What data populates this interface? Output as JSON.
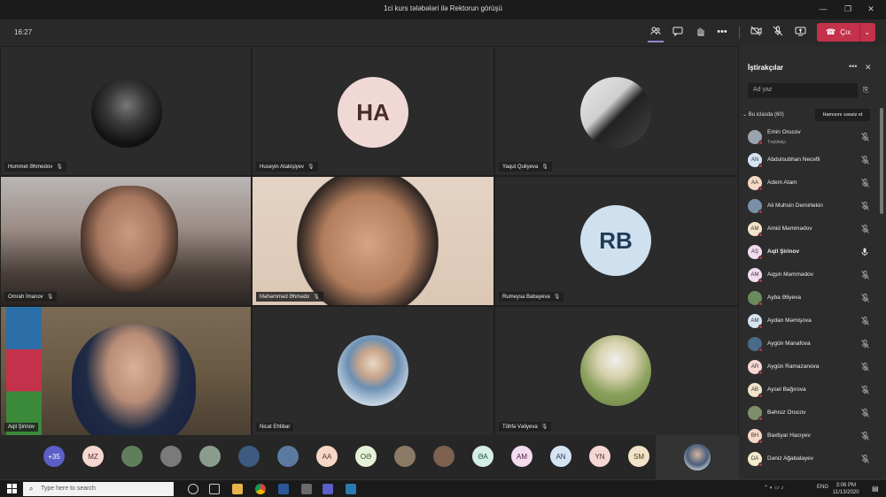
{
  "window": {
    "title": "1ci kurs tələbələri ilə Rektorun görüşü",
    "controls": {
      "minimize": "—",
      "maximize": "❐",
      "close": "✕"
    }
  },
  "toolbar": {
    "elapsed": "16:27",
    "leave_label": "Çıx",
    "icons": [
      "participants-icon",
      "chat-icon",
      "raise-hand-icon",
      "more-actions-icon",
      "camera-off-icon",
      "mic-off-icon",
      "share-screen-icon"
    ]
  },
  "tiles": [
    {
      "name": "Hummet Əhmedov",
      "type": "photo",
      "color": "#1a1a1a"
    },
    {
      "name": "Huseyin Atakişiyev",
      "type": "initials",
      "initials": "HA",
      "bg": "#f0d9d5",
      "fg": "#4a2b28"
    },
    {
      "name": "Yaqut Quliyeva",
      "type": "photo",
      "color": "#d9d9d9"
    },
    {
      "name": "Omrah İmanov",
      "type": "video",
      "color": "#8d8380"
    },
    {
      "name": "Məhəmməd Əhmədo",
      "type": "video",
      "color": "#c9a48c"
    },
    {
      "name": "Rumeysa Babayeva",
      "type": "initials",
      "initials": "RB",
      "bg": "#cfe0ee",
      "fg": "#1f3b57"
    },
    {
      "name": "Aqil Şirinov",
      "type": "video",
      "color": "#6b5940"
    },
    {
      "name": "Nicat Ehtibar",
      "type": "photo",
      "color": "#4a6c8c"
    },
    {
      "name": "Töhfə Vəliyeva",
      "type": "photo",
      "color": "#b7b085"
    }
  ],
  "strip": [
    {
      "label": "+35",
      "bg": "#5b5fc7",
      "fg": "#ffffff"
    },
    {
      "label": "MZ",
      "bg": "#f6d7d2",
      "fg": "#4a2b28"
    },
    {
      "label": "",
      "bg": "#607d5c",
      "fg": "#ffffff"
    },
    {
      "label": "",
      "bg": "#7a7a7a",
      "fg": "#ffffff"
    },
    {
      "label": "",
      "bg": "#8c9c8a",
      "fg": "#ffffff"
    },
    {
      "label": "",
      "bg": "#3d5a80",
      "fg": "#ffffff"
    },
    {
      "label": "",
      "bg": "#5a7aa0",
      "fg": "#ffffff"
    },
    {
      "label": "AA",
      "bg": "#f6d7c6",
      "fg": "#5a3020"
    },
    {
      "label": "OƏ",
      "bg": "#e5f2d9",
      "fg": "#2b4a1f"
    },
    {
      "label": "",
      "bg": "#8a7a66",
      "fg": "#ffffff"
    },
    {
      "label": "",
      "bg": "#7d6050",
      "fg": "#ffffff"
    },
    {
      "label": "ƏA",
      "bg": "#d6efe5",
      "fg": "#1f4a3a"
    },
    {
      "label": "AM",
      "bg": "#f3dcef",
      "fg": "#4a2046"
    },
    {
      "label": "AN",
      "bg": "#d5e4f2",
      "fg": "#1f3b57"
    },
    {
      "label": "YN",
      "bg": "#f6d7d2",
      "fg": "#4a2b28"
    },
    {
      "label": "SM",
      "bg": "#f1e4c9",
      "fg": "#4a3b1f"
    }
  ],
  "panel": {
    "title": "İştirakçılar",
    "search_placeholder": "Ad yaz",
    "section": "Bu iclasda (60)",
    "mute_all": "Hamısını səssiz et",
    "participants": [
      {
        "name": "Emin Orucov",
        "role": "Təşkilatçı",
        "initials": "",
        "bg": "#9aa3ad",
        "bold": false,
        "mic": "muted"
      },
      {
        "name": "Abdulsubhan Necefli",
        "role": "",
        "initials": "AN",
        "bg": "#d5e4f2",
        "bold": false,
        "mic": "muted"
      },
      {
        "name": "Adem Atam",
        "role": "",
        "initials": "AA",
        "bg": "#f6d7c6",
        "bold": false,
        "mic": "muted"
      },
      {
        "name": "Ali Muhsin Demirtekin",
        "role": "",
        "initials": "",
        "bg": "#7a8fa8",
        "bold": false,
        "mic": "muted"
      },
      {
        "name": "Amid Məmmədov",
        "role": "",
        "initials": "AM",
        "bg": "#f1e4c9",
        "bold": false,
        "mic": "muted"
      },
      {
        "name": "Aqil Şirinov",
        "role": "",
        "initials": "AŞ",
        "bg": "#f3dcef",
        "bold": true,
        "mic": "on"
      },
      {
        "name": "Aqşin Məmmədov",
        "role": "",
        "initials": "AM",
        "bg": "#f3dcef",
        "bold": false,
        "mic": "muted"
      },
      {
        "name": "Ayba Əliyeva",
        "role": "",
        "initials": "",
        "bg": "#6b8a5c",
        "bold": false,
        "mic": "muted"
      },
      {
        "name": "Aydan Məmişova",
        "role": "",
        "initials": "AM",
        "bg": "#d5e4f2",
        "bold": false,
        "mic": "muted"
      },
      {
        "name": "Aygün Manafova",
        "role": "",
        "initials": "",
        "bg": "#4a6a8a",
        "bold": false,
        "mic": "muted"
      },
      {
        "name": "Aygün Ramazanova",
        "role": "",
        "initials": "AR",
        "bg": "#f6d7d2",
        "bold": false,
        "mic": "muted"
      },
      {
        "name": "Aysel Bağırova",
        "role": "",
        "initials": "AB",
        "bg": "#f1e4c9",
        "bold": false,
        "mic": "muted"
      },
      {
        "name": "Bəhruz Orucov",
        "role": "",
        "initials": "",
        "bg": "#7d8f6a",
        "bold": false,
        "mic": "muted"
      },
      {
        "name": "Baxtiyar Hacıyev",
        "role": "",
        "initials": "BH",
        "bg": "#f6d7c6",
        "bold": false,
        "mic": "muted"
      },
      {
        "name": "Dəniz Ağabalayev",
        "role": "",
        "initials": "DA",
        "bg": "#f1ecc9",
        "bold": false,
        "mic": "muted"
      }
    ]
  },
  "taskbar": {
    "search_placeholder": "Type here to search",
    "lang": "ENG",
    "time": "3:06 PM",
    "date": "11/13/2020"
  }
}
